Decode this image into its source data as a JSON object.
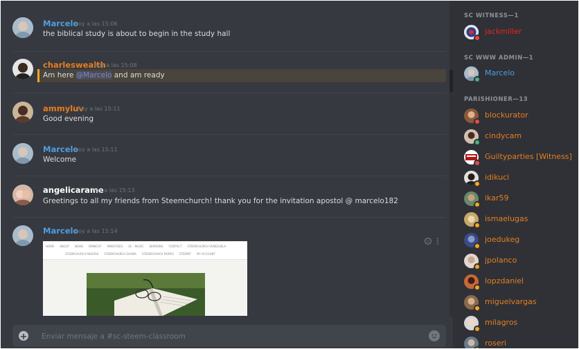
{
  "colors": {
    "blue_user": "#4f9de0",
    "orange_user": "#e67e22",
    "white_user": "#ffffff",
    "red_user": "#e8261f",
    "online": "#43b581",
    "idle": "#faa61a",
    "dnd": "#f04747"
  },
  "messages": [
    {
      "author": "Marcelo",
      "time": "hoy a las 15:06",
      "text": "the biblical study is about to begin in the study hall"
    },
    {
      "author": "charleswealth",
      "time": "hoy a las 15:08",
      "text_before": "Am here ",
      "mention": "@Marcelo",
      "text_after": " and am ready"
    },
    {
      "author": "ammyluv",
      "time": "hoy a las 15:11",
      "text": "Good evening"
    },
    {
      "author": "Marcelo",
      "time": "hoy a las 15:11",
      "text": "Welcome"
    },
    {
      "author": "angelicarame",
      "time": "hoy a las 15:13",
      "text": "Greetings to all my friends from Steemchurch! thank you for the invitation apostol @ marcelo182"
    },
    {
      "author": "Marcelo",
      "time": "hoy a las 15:14"
    }
  ],
  "embed": {
    "nav_row1": [
      "HOME",
      "ABOUT",
      "NEWS",
      "DIMKCHT",
      "MINISTRIES",
      "SC - MUSIC",
      "SERMONS",
      "CONTACT",
      "STEEMCHURCH VENEZUELA"
    ],
    "nav_row2": [
      "STEEMCHURCH NIGERIA",
      "STEEMCHURCH GHANA",
      "STEEMCHURCH PARRIS",
      "STEEMIT",
      "MY ACCOUNT"
    ]
  },
  "composer": {
    "placeholder": "Enviar mensaje a #sc-steem-classroom"
  },
  "members": {
    "groups": [
      {
        "title": "SC WITNESS—1",
        "users": [
          {
            "name": "jackmiller",
            "status": "dnd"
          }
        ]
      },
      {
        "title": "SC WWW ADMIN—1",
        "users": [
          {
            "name": "Marcelo",
            "status": "online"
          }
        ]
      },
      {
        "title": "PARISHIONER—13",
        "users": [
          {
            "name": "blockurator",
            "status": "dnd"
          },
          {
            "name": "cindycam",
            "status": "online"
          },
          {
            "name": "Guiltyparties [Witness]",
            "status": "dnd"
          },
          {
            "name": "idikuci",
            "status": "idle"
          },
          {
            "name": "ikar59",
            "status": "idle"
          },
          {
            "name": "ismaelugas",
            "status": "idle"
          },
          {
            "name": "joedukeg",
            "status": "idle"
          },
          {
            "name": "jpolanco",
            "status": "idle"
          },
          {
            "name": "lopzdaniel",
            "status": "idle"
          },
          {
            "name": "miguelvargas",
            "status": "idle"
          },
          {
            "name": "milagros",
            "status": "idle"
          },
          {
            "name": "roseri",
            "status": "idle"
          }
        ]
      }
    ]
  }
}
